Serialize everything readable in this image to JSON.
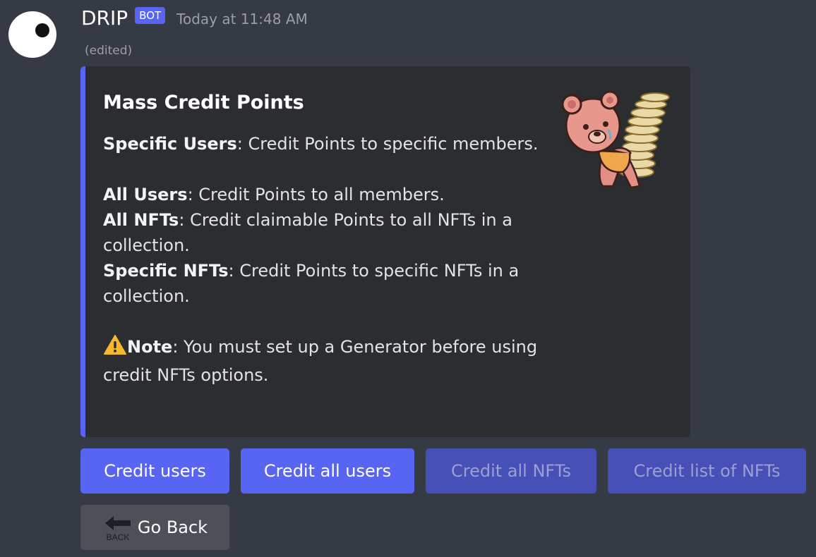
{
  "message": {
    "author": "DRIP",
    "badge": "BOT",
    "timestamp": "Today at 11:48 AM",
    "edited": "(edited)"
  },
  "embed": {
    "accent_color": "#5865f2",
    "title": "Mass Credit Points",
    "items": [
      {
        "label": "Specific Users",
        "text": ": Credit Points to specific members."
      },
      {
        "label": "All Users",
        "text": ": Credit Points to all members."
      },
      {
        "label": "All NFTs",
        "text_line1": ": Credit claimable Points to all NFTs in a",
        "text_line2": "collection."
      },
      {
        "label": "Specific NFTs",
        "text_line1": ": Credit Points to specific NFTs in a",
        "text_line2": "collection."
      }
    ],
    "note": {
      "icon": "warning-icon",
      "label": "Note",
      "text_line1": ": You must set up a Generator before using",
      "text_line2": "credit NFTs options."
    },
    "thumbnail": "bear-carrying-coins-image"
  },
  "buttons": {
    "credit_users": "Credit users",
    "credit_all_users": "Credit all users",
    "credit_all_nfts": "Credit all NFTs",
    "credit_list_nfts": "Credit list of NFTs",
    "go_back": "Go Back",
    "back_icon_text": "BACK"
  }
}
